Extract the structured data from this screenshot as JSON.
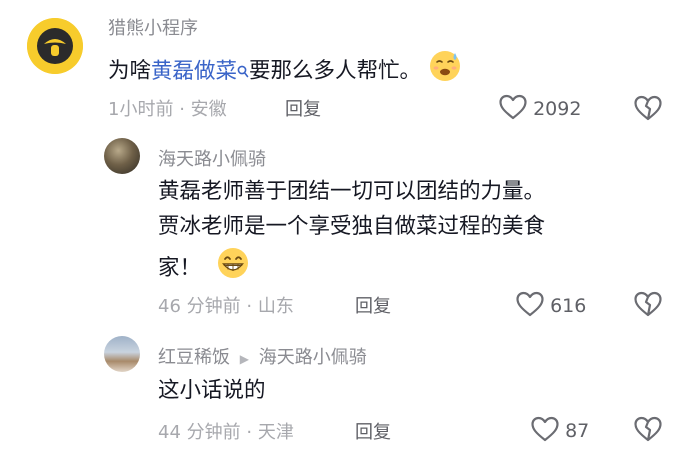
{
  "comment1": {
    "username": "猎熊小程序",
    "text_before": "为啥",
    "link": "黄磊做菜",
    "text_after": "要那么多人帮忙。",
    "emoji": "sweat-smile-emoji",
    "time": "1小时前",
    "sep": "·",
    "location": "安徽",
    "reply_label": "回复",
    "likes": "2092"
  },
  "reply1": {
    "username": "海天路小佩骑",
    "line1": "黄磊老师善于团结一切可以团结的力量。",
    "line2": "贾冰老师是一个享受独自做菜过程的美食",
    "line3": "家！",
    "emoji": "grin-emoji",
    "time": "46 分钟前",
    "sep": "·",
    "location": "山东",
    "reply_label": "回复",
    "likes": "616"
  },
  "reply2": {
    "username": "红豆稀饭",
    "reply_to": "海天路小佩骑",
    "text": "这小话说的",
    "time": "44 分钟前",
    "sep": "·",
    "location": "天津",
    "reply_label": "回复",
    "likes": "87"
  },
  "colors": {
    "link": "#3a64c8",
    "avatar_bg": "#f7cc2c",
    "muted": "#a7a8ad"
  },
  "icons": [
    "heart-icon",
    "broken-heart-icon",
    "search-icon",
    "reply-arrow-icon"
  ]
}
